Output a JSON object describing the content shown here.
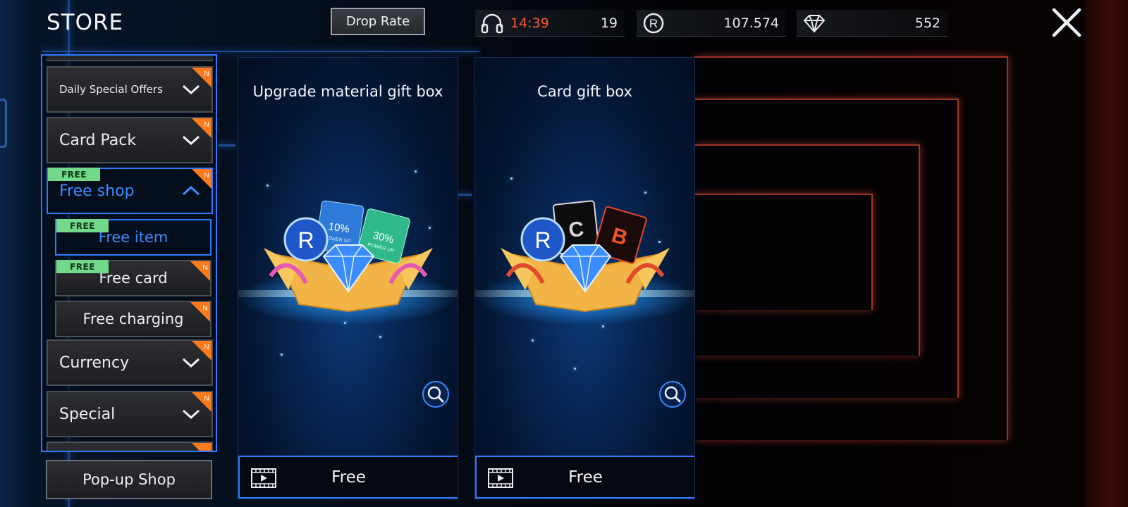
{
  "header": {
    "title": "STORE",
    "drop_rate_label": "Drop Rate",
    "close_icon": "close-icon"
  },
  "resources": {
    "energy": {
      "icon": "headphones-icon",
      "timer": "14:39",
      "count": "19"
    },
    "coins": {
      "icon": "r-coin-icon",
      "amount": "107.574"
    },
    "gems": {
      "icon": "diamond-icon",
      "amount": "552"
    }
  },
  "menu": {
    "categories": [
      {
        "label": "Daily Special Offers",
        "badge": "N"
      },
      {
        "label": "Card Pack",
        "badge": "N"
      },
      {
        "label": "Free shop",
        "badge": "N",
        "tag": "FREE",
        "expanded": true
      },
      {
        "label": "Currency",
        "badge": "N"
      },
      {
        "label": "Special",
        "badge": "N"
      }
    ],
    "subitems": [
      {
        "label": "Free item",
        "tag": "FREE",
        "selected": true
      },
      {
        "label": "Free card",
        "tag": "FREE",
        "badge": "N"
      },
      {
        "label": "Free charging",
        "badge": "N"
      }
    ],
    "popup_shop_label": "Pop-up Shop"
  },
  "products": [
    {
      "title": "Upgrade material gift box",
      "price": "Free",
      "price_icon": "video-ad-icon",
      "contents": [
        "R",
        "10%",
        "POWER UP",
        "30%",
        "POWER UP"
      ]
    },
    {
      "title": "Card gift box",
      "price": "Free",
      "price_icon": "video-ad-icon",
      "contents": [
        "R",
        "C",
        "B"
      ]
    }
  ],
  "colors": {
    "accent_blue": "#2e7bff",
    "timer_red": "#ff5638",
    "free_tag_green": "#72d88a",
    "new_badge_orange": "#ff7a1a"
  }
}
